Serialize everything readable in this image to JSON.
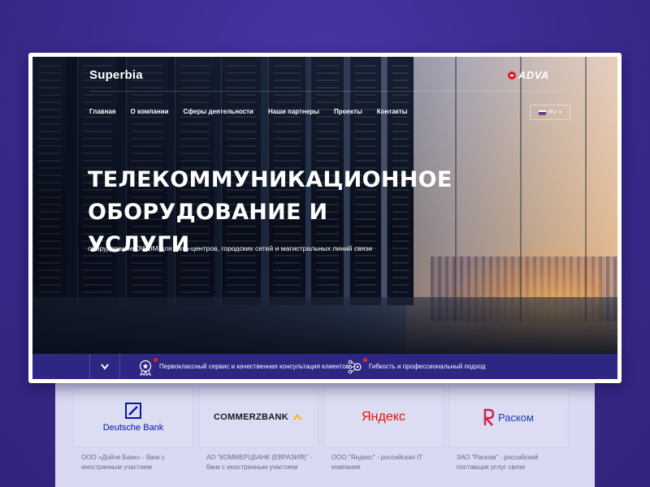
{
  "site": {
    "brand": "Superbia",
    "partner_logo": "ADVA",
    "nav": [
      "Главная",
      "О компании",
      "Сферы деятельности",
      "Наши партнеры",
      "Проекты",
      "Контакты"
    ],
    "language": "RU",
    "hero_title": "ТЕЛЕКОММУНИКАЦИОННОЕ\nОБОРУДОВАНИЕ И УСЛУГИ",
    "hero_subtitle": "оборудование DWDM для дата-центров, городских сетей и магистральных линий связи",
    "features": [
      {
        "icon": "award-icon",
        "text": "Первоклассный сервис и качественная консультация клиентов"
      },
      {
        "icon": "network-icon",
        "text": "Гибкость и профессиональный подход"
      }
    ]
  },
  "partners": [
    {
      "name": "Deutsche Bank",
      "desc": "ООО «Дойче Банк» - банк с иностранным участием",
      "color": "#0018a8"
    },
    {
      "name": "COMMERZBANK",
      "desc": "АО \"КОММЕРЦБАНК (ЕВРАЗИЯ)\" - банк с иностранным участием",
      "color": "#1a1a1a"
    },
    {
      "name": "Яндекс",
      "desc": "ООО \"Яндекс\" - российская IT компания",
      "color": "#e61400"
    },
    {
      "name": "Раском",
      "desc": "ЗАО \"Раском\" - российский поставщик услуг связи",
      "color": "#1f3fb0"
    }
  ],
  "colors": {
    "background": "#3a2a8c",
    "bar": "#2e2683",
    "accent_red": "#e1262d"
  }
}
